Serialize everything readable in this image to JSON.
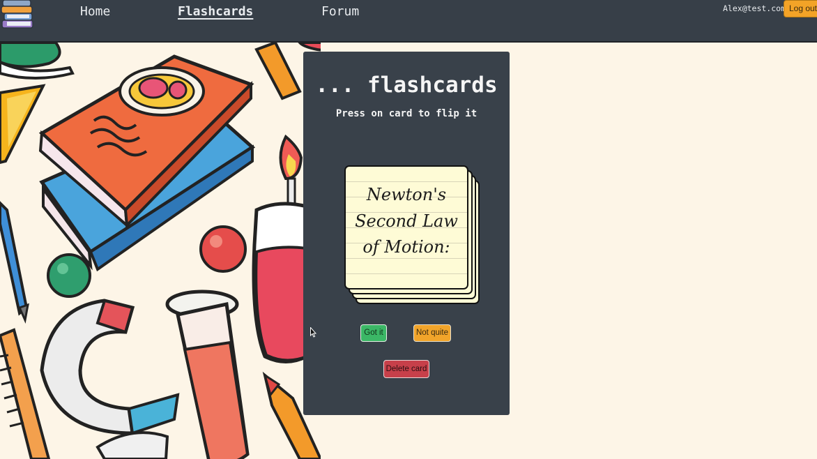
{
  "nav": {
    "links": [
      {
        "label": "Home"
      },
      {
        "label": "Flashcards"
      },
      {
        "label": "Forum"
      }
    ],
    "user_email": "Alex@test.com",
    "logout_label": "Log out"
  },
  "panel": {
    "title": "... flashcards",
    "subtitle": "Press on card to flip it",
    "card_text": "Newton's Second Law of Motion:",
    "buttons": {
      "got_it": "Got it",
      "not_quite": "Not quite",
      "delete": "Delete card"
    }
  },
  "colors": {
    "navbar": "#373f48",
    "panel": "#39414a",
    "page_background": "#fdf5e7",
    "card": "#fefbd6",
    "got_it": "#3bb766",
    "not_quite": "#f1a42a",
    "delete": "#c7404a",
    "logout": "#f3a327"
  },
  "icons": [
    "books-logo-icon",
    "mouse-cursor-icon"
  ]
}
